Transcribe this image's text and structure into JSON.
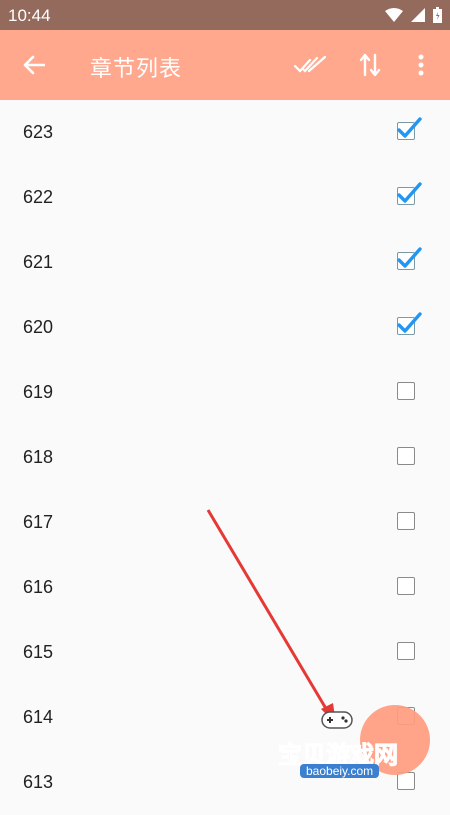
{
  "status_bar": {
    "time": "10:44"
  },
  "app_bar": {
    "title": "章节列表",
    "back_icon": "arrow-left-icon",
    "select_all_icon": "double-check-icon",
    "sort_icon": "swap-vertical-icon",
    "more_icon": "more-vertical-icon"
  },
  "chapters": [
    {
      "label": "623",
      "checked": true
    },
    {
      "label": "622",
      "checked": true
    },
    {
      "label": "621",
      "checked": true
    },
    {
      "label": "620",
      "checked": true
    },
    {
      "label": "619",
      "checked": false
    },
    {
      "label": "618",
      "checked": false
    },
    {
      "label": "617",
      "checked": false
    },
    {
      "label": "616",
      "checked": false
    },
    {
      "label": "615",
      "checked": false
    },
    {
      "label": "614",
      "checked": false
    },
    {
      "label": "613",
      "checked": false
    }
  ],
  "watermark": {
    "text": "宝贝游戏网",
    "url": "baobeiy.com"
  },
  "colors": {
    "app_bar": "#ffa88e",
    "status_bar": "#946a5c",
    "check": "#2196f3",
    "arrow": "#e53935"
  }
}
